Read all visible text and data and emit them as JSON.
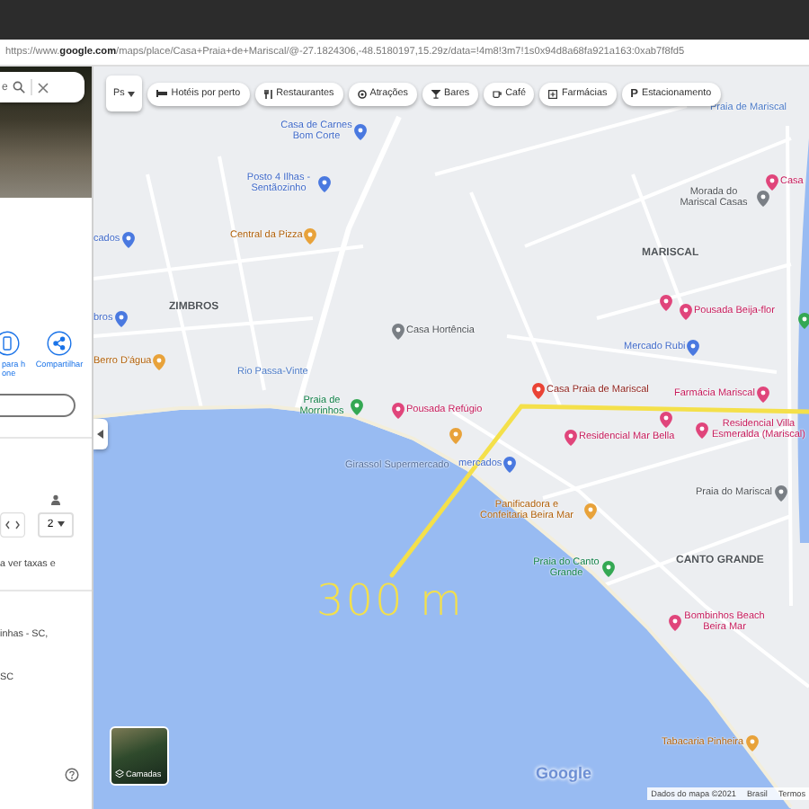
{
  "browser": {
    "url": "https://www.**google.com**/maps/place/Casa+Praia+de+Mariscal/@-27.1824306,-48.5180197,15.29z/data=!4m8!3m7!1s0x94d8a68fa921a163:0xab7f8fd5"
  },
  "side_panel": {
    "search": {
      "value": "e"
    },
    "actions": [
      {
        "label": "para hone",
        "kind": "phone"
      },
      {
        "label": "Compartilhar",
        "kind": "share"
      }
    ],
    "guests": "2",
    "rates_text": "a ver taxas e",
    "address_line": "inhas - SC,",
    "address_line_2": "SC"
  },
  "chips": [
    {
      "label": "Ps",
      "kind": "search"
    },
    {
      "label": "Hotéis por perto",
      "kind": "hotel"
    },
    {
      "label": "Restaurantes",
      "kind": "restaurant"
    },
    {
      "label": "Atrações",
      "kind": "attraction"
    },
    {
      "label": "Bares",
      "kind": "bar"
    },
    {
      "label": "Café",
      "kind": "cafe"
    },
    {
      "label": "Farmácias",
      "kind": "pharmacy"
    },
    {
      "label": "Estacionamento",
      "kind": "parking",
      "icon_text": "P"
    }
  ],
  "map": {
    "places": [
      {
        "label": "Casa de Carnes Bom Corte",
        "kind": "shopping"
      },
      {
        "label": "Posto 4 Ilhas - Sentãozinho",
        "kind": "shopping"
      },
      {
        "label": "Central da Pizza",
        "kind": "food"
      },
      {
        "label": "cados",
        "kind": "shopping"
      },
      {
        "label": "ZIMBROS",
        "kind": "area"
      },
      {
        "label": "bros",
        "kind": "shopping"
      },
      {
        "label": "Berro D'água",
        "kind": "food"
      },
      {
        "label": "Rio Passa-Vinte",
        "kind": "water"
      },
      {
        "label": "Praia de Morrinhos",
        "kind": "park"
      },
      {
        "label": "Casa Hortência",
        "kind": "place"
      },
      {
        "label": "Pousada Refúgio",
        "kind": "lodging"
      },
      {
        "label": "Praia de Mariscal",
        "kind": "water"
      },
      {
        "label": "Morada do Mariscal Casas",
        "kind": "place"
      },
      {
        "label": "Casa",
        "kind": "lodging"
      },
      {
        "label": "MARISCAL",
        "kind": "area"
      },
      {
        "label": "Pousada Beija-flor",
        "kind": "lodging"
      },
      {
        "label": "Mercado Rubi",
        "kind": "shopping"
      },
      {
        "label": "Casa Praia de Mariscal",
        "kind": "selected"
      },
      {
        "label": "Farmácia Mariscal",
        "kind": "health"
      },
      {
        "label": "Residencial Mar Bella",
        "kind": "lodging"
      },
      {
        "label": "Residencial Villa Esmeralda (Mariscal)",
        "kind": "lodging"
      },
      {
        "label": "Girassol Supermercado",
        "kind": "faded"
      },
      {
        "label": "mercados",
        "kind": "shopping"
      },
      {
        "label": "Panificadora e Confeitaria Beira Mar",
        "kind": "food"
      },
      {
        "label": "Praia do Mariscal",
        "kind": "place"
      },
      {
        "label": "Praia do Canto Grande",
        "kind": "park"
      },
      {
        "label": "CANTO GRANDE",
        "kind": "area"
      },
      {
        "label": "Bombinhos Beach Beira Mar",
        "kind": "lodging"
      },
      {
        "label": "Tabacaria Pinheira",
        "kind": "food"
      }
    ],
    "pins": [
      {
        "kind": "lodging"
      },
      {
        "kind": "lodging"
      },
      {
        "kind": "food"
      },
      {
        "kind": "park"
      }
    ],
    "annotation": "300 m",
    "layers_label": "Camadas",
    "logo": "Google",
    "attribution": [
      "Dados do mapa ©2021",
      "Brasil",
      "Termos"
    ]
  }
}
